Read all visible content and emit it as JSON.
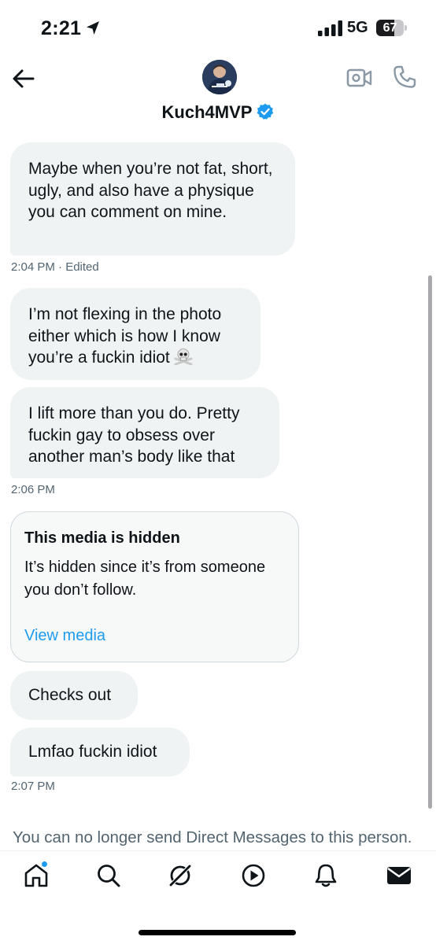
{
  "status_bar": {
    "time": "2:21",
    "network": "5G",
    "battery_level": "67",
    "battery_fraction": 0.67
  },
  "header": {
    "display_name": "Kuch4MVP",
    "verified": true
  },
  "messages": [
    {
      "text": "Maybe when you’re not fat, short, ugly, and also have a physique you can comment on mine.",
      "emoji": ""
    },
    {
      "text": "I’m not flexing in the photo either which is how I know you’re a fuckin idiot",
      "emoji": "skull-crossbones"
    },
    {
      "text": "I lift more than you do. Pretty fuckin gay to obsess over another man’s body like that",
      "emoji": ""
    },
    {
      "text": "Checks out",
      "emoji": ""
    },
    {
      "text": "Lmfao fuckin idiot",
      "emoji": ""
    }
  ],
  "timestamps": [
    "2:04 PM · Edited",
    "2:06 PM",
    "2:07 PM"
  ],
  "hidden_media": {
    "title": "This media is hidden",
    "body": "It’s hidden since it’s from someone you don’t follow.",
    "link": "View media"
  },
  "notice": "You can no longer send Direct Messages to this person.",
  "tab_bar": [
    {
      "icon": "home-icon",
      "active": false,
      "badge": true
    },
    {
      "icon": "search-icon",
      "active": false,
      "badge": false
    },
    {
      "icon": "grok-icon",
      "active": false,
      "badge": false
    },
    {
      "icon": "play-icon",
      "active": false,
      "badge": false
    },
    {
      "icon": "bell-icon",
      "active": false,
      "badge": false
    },
    {
      "icon": "mail-icon",
      "active": true,
      "badge": false
    }
  ],
  "colors": {
    "accent": "#1d9bf0",
    "bubble": "#eff3f4",
    "text": "#0f1419",
    "secondary_text": "#536471"
  }
}
